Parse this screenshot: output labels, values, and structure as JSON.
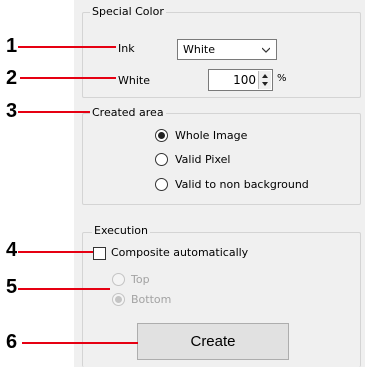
{
  "special_color": {
    "title": "Special Color",
    "ink_label": "Ink",
    "ink_value": "White",
    "white_label": "White",
    "white_value": "100",
    "white_unit": "%"
  },
  "created_area": {
    "title": "Created area",
    "options": [
      {
        "label": "Whole Image",
        "checked": true
      },
      {
        "label": "Valid Pixel",
        "checked": false
      },
      {
        "label": "Valid to non background",
        "checked": false
      }
    ]
  },
  "execution": {
    "title": "Execution",
    "composite_label": "Composite automatically",
    "composite_checked": false,
    "position_options": [
      {
        "label": "Top",
        "checked": false,
        "enabled": false
      },
      {
        "label": "Bottom",
        "checked": true,
        "enabled": false
      }
    ],
    "create_label": "Create"
  },
  "callouts": [
    "1",
    "2",
    "3",
    "4",
    "5",
    "6"
  ],
  "colors": {
    "callout_line": "#e60012",
    "panel_bg": "#f0f0f0"
  }
}
